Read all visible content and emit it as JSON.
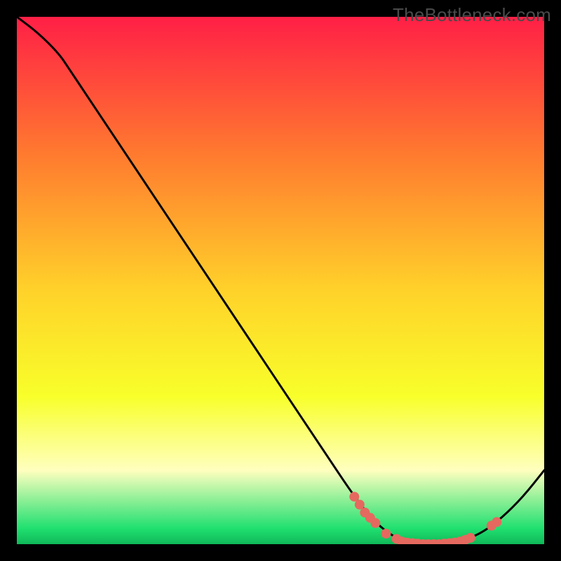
{
  "watermark": "TheBottleneck.com",
  "colors": {
    "background": "#000000",
    "gradient_top": "#ff1f46",
    "gradient_mid_upper": "#ff7a2f",
    "gradient_mid": "#ffd22a",
    "gradient_mid_lower": "#f8ff2a",
    "gradient_pale": "#ffffbf",
    "gradient_green": "#20e070",
    "curve_stroke": "#000000",
    "marker_fill": "#e5695f"
  },
  "chart_data": {
    "type": "line",
    "title": "",
    "xlabel": "",
    "ylabel": "",
    "xlim": [
      0,
      100
    ],
    "ylim": [
      0,
      100
    ],
    "curve": [
      {
        "x": 0,
        "y": 100
      },
      {
        "x": 4,
        "y": 97
      },
      {
        "x": 8,
        "y": 93
      },
      {
        "x": 10,
        "y": 90
      },
      {
        "x": 14,
        "y": 84
      },
      {
        "x": 20,
        "y": 75
      },
      {
        "x": 30,
        "y": 60
      },
      {
        "x": 40,
        "y": 45
      },
      {
        "x": 50,
        "y": 30
      },
      {
        "x": 58,
        "y": 18
      },
      {
        "x": 64,
        "y": 9
      },
      {
        "x": 68,
        "y": 4
      },
      {
        "x": 72,
        "y": 1
      },
      {
        "x": 76,
        "y": 0
      },
      {
        "x": 80,
        "y": 0
      },
      {
        "x": 84,
        "y": 0.5
      },
      {
        "x": 88,
        "y": 2
      },
      {
        "x": 92,
        "y": 5
      },
      {
        "x": 96,
        "y": 9
      },
      {
        "x": 100,
        "y": 14
      }
    ],
    "markers": [
      {
        "x": 64,
        "y": 9
      },
      {
        "x": 65,
        "y": 7.5
      },
      {
        "x": 66,
        "y": 6
      },
      {
        "x": 67,
        "y": 5
      },
      {
        "x": 68,
        "y": 4
      },
      {
        "x": 70,
        "y": 2
      },
      {
        "x": 72,
        "y": 1
      },
      {
        "x": 73,
        "y": 0.5
      },
      {
        "x": 74,
        "y": 0.3
      },
      {
        "x": 75,
        "y": 0.2
      },
      {
        "x": 76,
        "y": 0.1
      },
      {
        "x": 77,
        "y": 0
      },
      {
        "x": 78,
        "y": 0
      },
      {
        "x": 79,
        "y": 0
      },
      {
        "x": 80,
        "y": 0
      },
      {
        "x": 81,
        "y": 0.1
      },
      {
        "x": 82,
        "y": 0.2
      },
      {
        "x": 83,
        "y": 0.3
      },
      {
        "x": 84,
        "y": 0.5
      },
      {
        "x": 85,
        "y": 0.8
      },
      {
        "x": 86,
        "y": 1.2
      },
      {
        "x": 90,
        "y": 3.5
      },
      {
        "x": 91,
        "y": 4.2
      }
    ]
  }
}
